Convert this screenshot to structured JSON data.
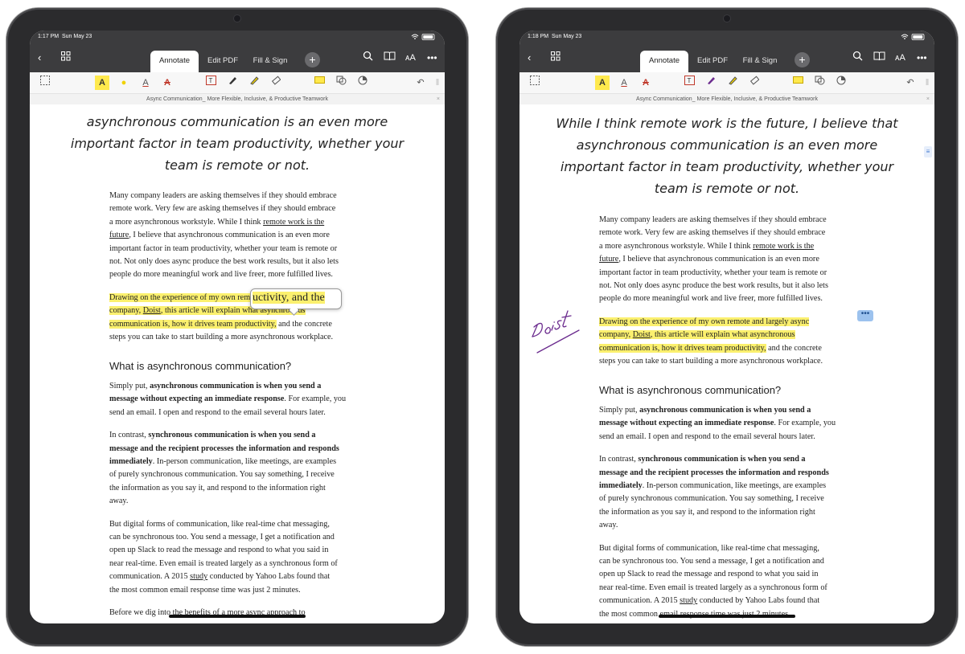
{
  "colors": {
    "bezel": "#2b2b2d",
    "bar": "#3c3c3e",
    "highlight": "#fbf06e",
    "ink": "#6b2b8e"
  },
  "left": {
    "status": {
      "time": "1:17 PM",
      "date": "Sun May 23"
    },
    "tabs": [
      "Annotate",
      "Edit PDF",
      "Fill & Sign"
    ],
    "doc_title": "Async Communication_ More Flexible, Inclusive, & Productive Teamwork",
    "quote": [
      "asynchronous communication is an even more",
      "important factor in team productivity, whether your",
      "team is remote or not."
    ],
    "para1": [
      "Many company leaders are asking themselves if they should embrace",
      "remote work. Very few are asking themselves if they should embrace",
      "a more asynchronous workstyle. While I think ",
      "remote work is the",
      "future",
      ", I believe that asynchronous communication is an even more",
      "important factor in team productivity, whether your team is remote or",
      "not. Not only does async produce the best work results, but it also lets",
      "people do more meaningful work and live freer, more fulfilled lives."
    ],
    "para2": [
      "Drawing on the experience of my own ",
      "remote and largely async",
      "company, ",
      "Doist",
      ", this article will explain what asynchronous",
      "communication is, how it drives team productivity,",
      " and the concrete",
      "steps you can take to start building a more asynchronous workplace."
    ],
    "magnifier": "uctivity, and the",
    "heading": "What is asynchronous communication?",
    "para3": [
      "Simply put, ",
      "asynchronous communication is when you send a",
      "message without expecting an immediate response",
      ". For example, you",
      "send an email. I open and respond to the email several hours later."
    ],
    "para4": [
      "In contrast, ",
      "synchronous communication is when you send a",
      "message and the recipient processes the information and responds",
      "immediately",
      ". In-person communication, like meetings, are examples",
      "of purely synchronous communication. You say something, I receive",
      "the information as you say it, and respond to the information right",
      "away."
    ],
    "para5": [
      "But digital forms of communication, like real-time chat messaging,",
      "can be synchronous too. You send a message, I get a notification and",
      "open up Slack to read the message and respond to what you said in",
      "near real-time. Even email is treated largely as a synchronous form of",
      "communication. A 2015 ",
      "study",
      " conducted by Yahoo Labs found that",
      "the most common email response time was just 2 minutes."
    ],
    "para6": "Before we dig into the benefits of a more async approach to"
  },
  "right": {
    "status": {
      "time": "1:18 PM",
      "date": "Sun May 23"
    },
    "tabs": [
      "Annotate",
      "Edit PDF",
      "Fill & Sign"
    ],
    "doc_title": "Async Communication_ More Flexible, Inclusive, & Productive Teamwork",
    "quote": [
      "While I think remote work is the future, I believe that",
      "asynchronous communication is an even more",
      "important factor in team productivity, whether your",
      "team is remote or not."
    ],
    "signature": "Doist",
    "comment_icon": "•••"
  }
}
